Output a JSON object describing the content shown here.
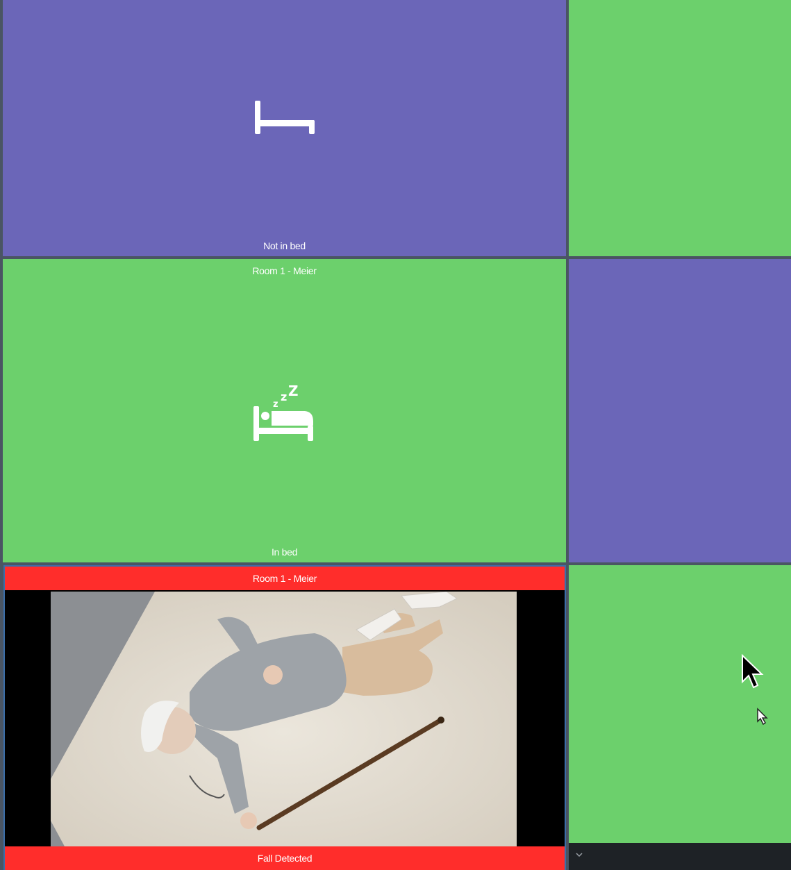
{
  "tiles": {
    "top_left": {
      "status": "Not in bed",
      "icon": "empty-bed-icon",
      "color": "#6b66b8"
    },
    "top_right": {
      "color": "#6cd06c"
    },
    "middle_left": {
      "room": "Room 1 - Meier",
      "status": "In bed",
      "icon": "sleeping-in-bed-icon",
      "color": "#6cd06c"
    },
    "middle_right": {
      "color": "#6b66b8"
    },
    "bottom_left": {
      "room": "Room 1 - Meier",
      "status": "Fall Detected",
      "alert_color": "#ff2d2b",
      "image": "fallen-person-photo"
    },
    "bottom_right": {
      "color": "#6cd06c",
      "toolbar_icon": "chevron-down-icon"
    }
  },
  "cursors": [
    "mouse-pointer-icon",
    "mouse-pointer-icon"
  ]
}
